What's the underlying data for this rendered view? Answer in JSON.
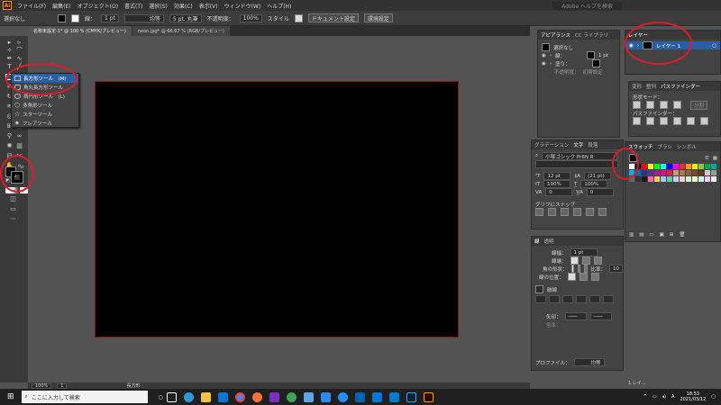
{
  "menubar": {
    "items": [
      "ファイル(F)",
      "編集(E)",
      "オブジェクト(O)",
      "書式(T)",
      "選択(S)",
      "効果(C)",
      "表示(V)",
      "ウィンドウ(W)",
      "ヘルプ(H)"
    ],
    "search": "Adobe ヘルプを検索"
  },
  "ctrlbar": {
    "no_selection": "選択なし",
    "stroke_label": "線：",
    "stroke_value": "1 pt",
    "uniform": "均等",
    "brush": "5 pt. 丸筆",
    "opacity_label": "不透明度：",
    "opacity_value": "100%",
    "style_label": "スタイル",
    "doc_settings": "ドキュメント設定",
    "prefs": "環境設定"
  },
  "tabs": [
    "名称未設定-1* @ 100 % (CMYK/プレビュー)",
    "neon.jpg* @ 66.67 % (RGB/プレビュー)"
  ],
  "flyout": {
    "items": [
      "長方形ツール　(M)",
      "角丸長方形ツール",
      "楕円形ツール　(L)",
      "多角形ツール",
      "スターツール",
      "フレアツール"
    ]
  },
  "appearance": {
    "tabs": [
      "アピアランス",
      "CC ライブラリ"
    ],
    "selection": "選択なし",
    "stroke": "線：",
    "stroke_value": "1 pt",
    "fill": "塗り：",
    "opacity": "不透明度：",
    "opacity_value": "初期設定"
  },
  "layers": {
    "tab": "レイヤー",
    "layer_name": "レイヤー 1",
    "count": "1 レイ..."
  },
  "transform": {
    "tabs": [
      "変形",
      "整列",
      "パスファインダー"
    ],
    "shape_mode": "形状モード：",
    "pathfinder": "パスファインダー：",
    "apply": "分割"
  },
  "char": {
    "tabs": [
      "グラデーション",
      "文字",
      "段落"
    ],
    "font": "小塚ゴシック Pr6N R",
    "size": "12 pt",
    "leading": "(21 pt)",
    "hscale": "100%",
    "vscale": "100%",
    "tracking": "0",
    "kerning": "0",
    "snap": "グリフにスナップ"
  },
  "swatches": {
    "tabs": [
      "スウォッチ",
      "ブラシ",
      "シンボル"
    ]
  },
  "strokepanel": {
    "tabs": [
      "線",
      "透明"
    ],
    "weight_label": "線幅：",
    "weight": "1 pt",
    "cap_label": "線端：",
    "corner_label": "角の形状：",
    "limit_label": "比率：",
    "limit": "10",
    "align_label": "線の位置：",
    "dash": "破線",
    "arrow": "矢印：",
    "scale": "倍率：",
    "profile": "プロファイル：",
    "profile_value": "均等"
  },
  "status": {
    "zoom": "100%",
    "page": "1",
    "tool": "長方形"
  },
  "taskbar": {
    "search": "ここに入力して検索",
    "time": "18:53",
    "date": "2021/03/12"
  },
  "colors": {
    "accent": "#2b5fa4",
    "circle": "#e01a2a",
    "artboard": "#000000"
  }
}
